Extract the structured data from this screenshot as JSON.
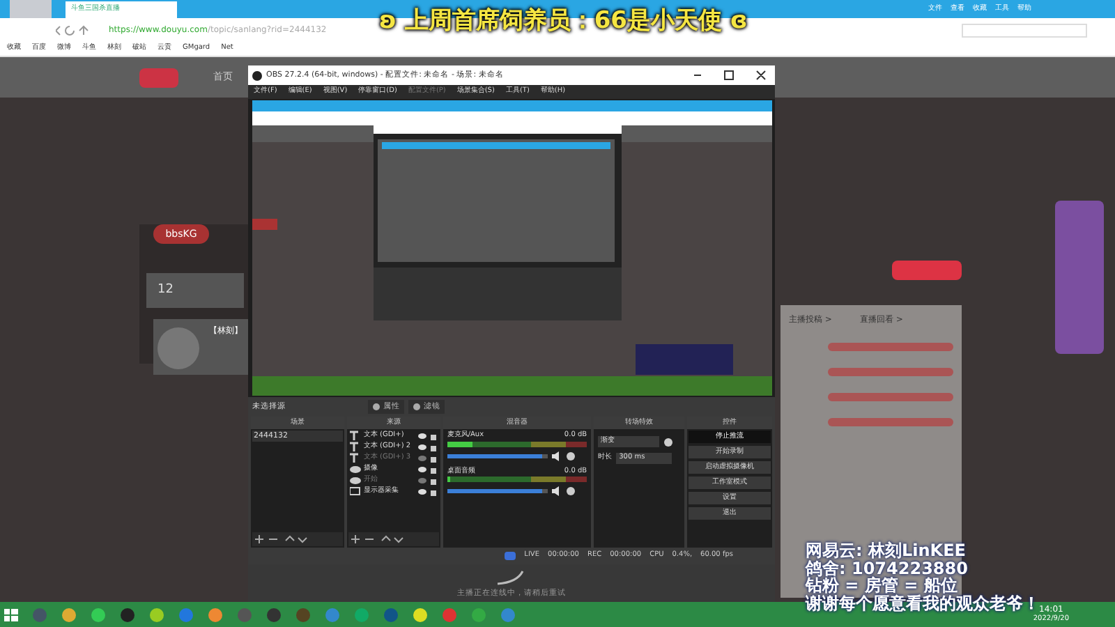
{
  "browser": {
    "tab_title": "斗鱼三国杀直播",
    "url_host": "https://www.douyu.com",
    "url_path": "/topic/sanlang?rid=2444132",
    "menu": [
      "文件",
      "查看",
      "收藏",
      "工具",
      "帮助"
    ],
    "bookmarks": [
      "收藏",
      "百度",
      "微博",
      "斗鱼",
      "林刻",
      "破站",
      "云贡",
      "GMgard",
      "Net"
    ]
  },
  "stream_title": "ʚ 上周首席饲养员：66是小天使 ɞ",
  "douyu_page": {
    "nav": "首页",
    "follow_count": "12",
    "room_tag": "bbsKG",
    "streamer_tag": "【林刻】",
    "chat_links": [
      "主播投稿 >",
      "直播回看 >"
    ]
  },
  "obs": {
    "title": "OBS 27.2.4 (64-bit, windows) - 配置文件: 未命名 - 场景: 未命名",
    "menu": [
      {
        "label": "文件(F)",
        "disabled": false
      },
      {
        "label": "编辑(E)",
        "disabled": false
      },
      {
        "label": "视图(V)",
        "disabled": false
      },
      {
        "label": "停靠窗口(D)",
        "disabled": false
      },
      {
        "label": "配置文件(P)",
        "disabled": true
      },
      {
        "label": "场景集合(S)",
        "disabled": false
      },
      {
        "label": "工具(T)",
        "disabled": false
      },
      {
        "label": "帮助(H)",
        "disabled": false
      }
    ],
    "source_state": "未选择源",
    "source_buttons": [
      "属性",
      "滤镜"
    ],
    "dock_titles": [
      "场景",
      "来源",
      "混音器",
      "转场特效",
      "控件"
    ],
    "scenes": [
      {
        "name": "2444132",
        "selected": false
      }
    ],
    "sources": [
      {
        "kind": "text",
        "name": "文本 (GDI+)",
        "disabled": false
      },
      {
        "kind": "text",
        "name": "文本 (GDI+) 2",
        "disabled": false
      },
      {
        "kind": "text",
        "name": "文本 (GDI+) 3",
        "disabled": true
      },
      {
        "kind": "camera",
        "name": "摄像",
        "disabled": false
      },
      {
        "kind": "camera",
        "name": "开始",
        "disabled": true
      },
      {
        "kind": "display",
        "name": "显示器采集",
        "disabled": false
      }
    ],
    "mixer": [
      {
        "name": "麦克风/Aux",
        "reading": "0.0 dB",
        "level": 0.95
      },
      {
        "name": "桌面音频",
        "reading": "0.0 dB",
        "level": 0.95
      }
    ],
    "transition": {
      "type": "渐变",
      "duration_label": "时长",
      "duration": "300 ms"
    },
    "controls": [
      {
        "label": "停止推流",
        "active": true
      },
      {
        "label": "开始录制",
        "active": false
      },
      {
        "label": "启动虚拟摄像机",
        "active": false
      },
      {
        "label": "工作室模式",
        "active": false
      },
      {
        "label": "设置",
        "active": false
      },
      {
        "label": "退出",
        "active": false
      }
    ],
    "status": [
      "LIVE",
      "00:00:00",
      "REC",
      "00:00:00",
      "CPU",
      "0.4%,",
      "60.00 fps"
    ],
    "hint": "主播正在连线中，请稍后重试"
  },
  "caption": [
    "网易云: 林刻LinKEE",
    "鸽舍: 1074223880",
    "钻粉 = 房管 = 船位",
    "谢谢每个愿意看我的观众老爷！"
  ],
  "taskbar": {
    "time": "14:01",
    "date": "2022/9/20"
  }
}
